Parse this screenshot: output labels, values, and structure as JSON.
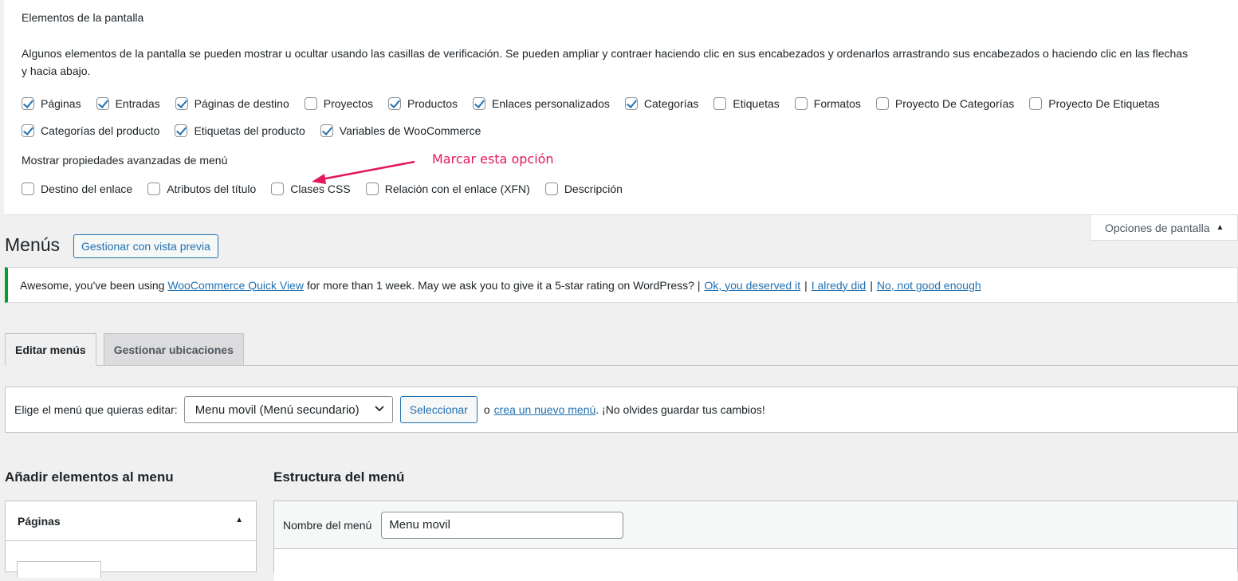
{
  "screen_options": {
    "heading": "Elementos de la pantalla",
    "description": "Algunos elementos de la pantalla se pueden mostrar u ocultar usando las casillas de verificación. Se pueden ampliar y contraer haciendo clic en sus encabezados y ordenarlos arrastrando sus encabezados o haciendo clic en las flechas",
    "description_line2": "y hacia abajo.",
    "row1": [
      {
        "label": "Páginas",
        "checked": true
      },
      {
        "label": "Entradas",
        "checked": true
      },
      {
        "label": "Páginas de destino",
        "checked": true
      },
      {
        "label": "Proyectos",
        "checked": false
      },
      {
        "label": "Productos",
        "checked": true
      },
      {
        "label": "Enlaces personalizados",
        "checked": true
      },
      {
        "label": "Categorías",
        "checked": true
      },
      {
        "label": "Etiquetas",
        "checked": false
      },
      {
        "label": "Formatos",
        "checked": false
      },
      {
        "label": "Proyecto De Categorías",
        "checked": false
      },
      {
        "label": "Proyecto De Etiquetas",
        "checked": false
      }
    ],
    "row2": [
      {
        "label": "Categorías del producto",
        "checked": true
      },
      {
        "label": "Etiquetas del producto",
        "checked": true
      },
      {
        "label": "Variables de WooCommerce",
        "checked": true
      }
    ],
    "advanced_heading": "Mostrar propiedades avanzadas de menú",
    "advanced": [
      {
        "label": "Destino del enlace",
        "checked": false
      },
      {
        "label": "Atributos del título",
        "checked": false
      },
      {
        "label": "Clases CSS",
        "checked": false
      },
      {
        "label": "Relación con el enlace (XFN)",
        "checked": false
      },
      {
        "label": "Descripción",
        "checked": false
      }
    ],
    "annotation": "Marcar esta opción",
    "annotation_color": "#e0195a",
    "toggle_label": "Opciones de pantalla"
  },
  "header": {
    "title": "Menús",
    "preview_button": "Gestionar con vista previa"
  },
  "notice": {
    "text_before": "Awesome, you've been using ",
    "plugin_link": "WooCommerce Quick View",
    "text_after": " for more than 1 week. May we ask you to give it a 5-star rating on WordPress? |",
    "link_ok": "Ok, you deserved it",
    "sep": "|",
    "link_did": "I alredy did",
    "link_no": "No, not good enough",
    "accent": "#00a32a"
  },
  "tabs": {
    "edit": "Editar menús",
    "locations": "Gestionar ubicaciones"
  },
  "select_bar": {
    "label": "Elige el menú que quieras editar:",
    "selected": "Menu movil (Menú secundario)",
    "button": "Seleccionar",
    "or": "o",
    "create_link": "crea un nuevo menú",
    "tail": ". ¡No olvides guardar tus cambios!"
  },
  "add_items": {
    "heading": "Añadir elementos al menu",
    "pages_box": "Páginas"
  },
  "structure": {
    "heading": "Estructura del menú",
    "name_label": "Nombre del menú",
    "name_value": "Menu movil"
  },
  "colors": {
    "link": "#2271b1",
    "checkbox_check": "#2271b1"
  }
}
